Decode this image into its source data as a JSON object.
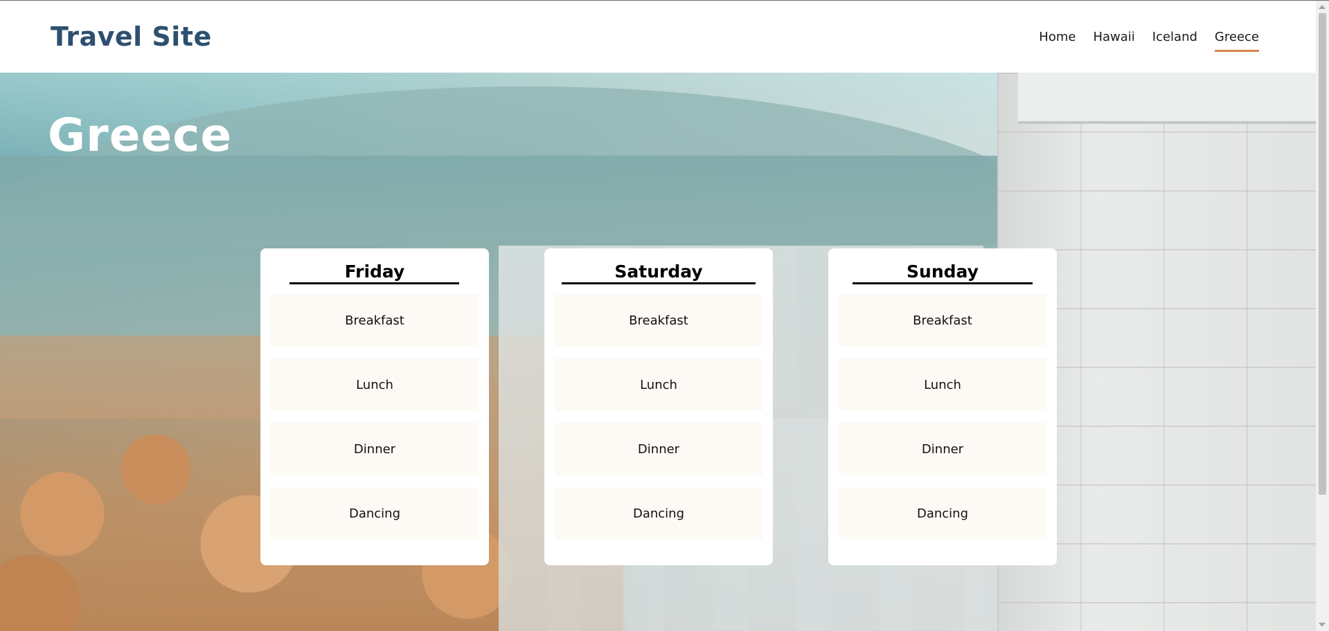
{
  "site": {
    "title": "Travel Site"
  },
  "nav": {
    "items": [
      {
        "label": "Home"
      },
      {
        "label": "Hawaii"
      },
      {
        "label": "Iceland"
      },
      {
        "label": "Greece",
        "active": true
      }
    ],
    "active_color": "#d9834b"
  },
  "hero": {
    "title": "Greece"
  },
  "days": [
    {
      "title": "Friday",
      "activities": [
        "Breakfast",
        "Lunch",
        "Dinner",
        "Dancing"
      ]
    },
    {
      "title": "Saturday",
      "activities": [
        "Breakfast",
        "Lunch",
        "Dinner",
        "Dancing"
      ]
    },
    {
      "title": "Sunday",
      "activities": [
        "Breakfast",
        "Lunch",
        "Dinner",
        "Dancing"
      ]
    }
  ],
  "colors": {
    "title_color": "#2e5070",
    "activity_background": "#fdfaf5"
  }
}
